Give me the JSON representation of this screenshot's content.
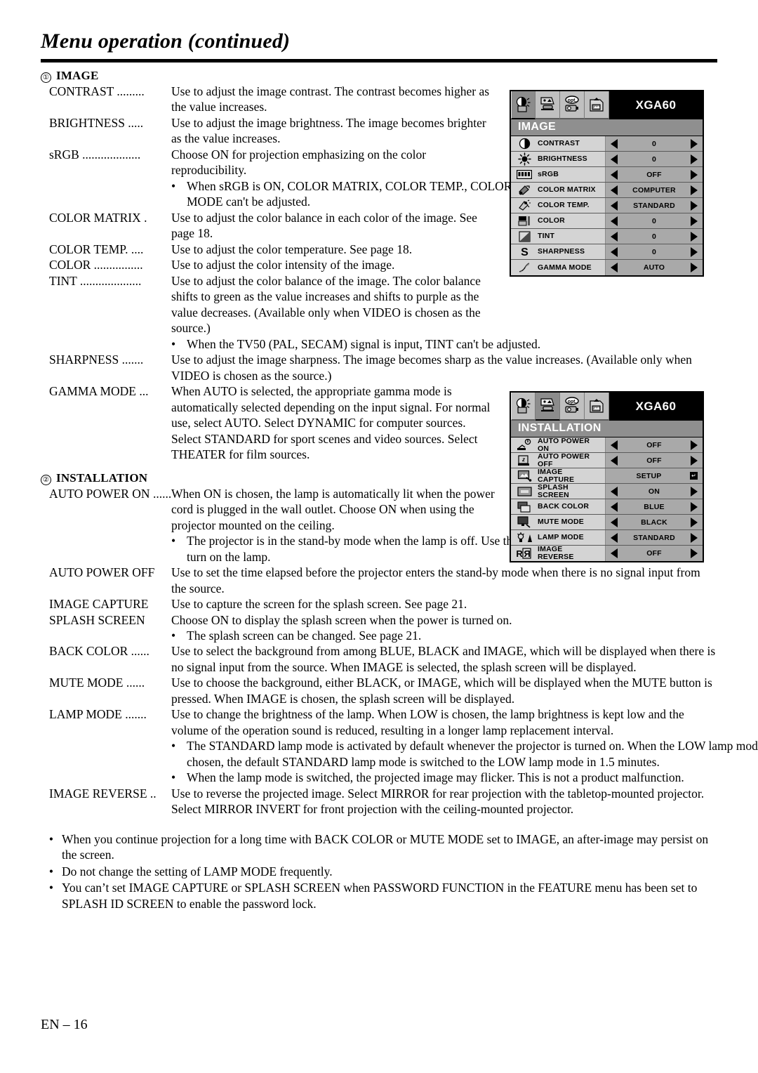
{
  "page": {
    "title": "Menu operation (continued)",
    "footer": "EN – 16"
  },
  "sections": [
    {
      "number": "①",
      "heading": "IMAGE",
      "entries": [
        {
          "term": "CONTRAST .........",
          "desc": "Use to adjust the image contrast. The contrast becomes higher as the value increases."
        },
        {
          "term": "BRIGHTNESS .....",
          "desc": "Use to adjust the image brightness. The image becomes brighter as the value increases."
        },
        {
          "term": "sRGB ...................",
          "desc": "Choose ON for projection emphasizing on the color reproducibility."
        },
        {
          "bullet": "When sRGB is ON, COLOR MATRIX, COLOR TEMP., COLOR, TINT, and GAMMA MODE can't be adjusted."
        },
        {
          "term": "COLOR MATRIX .",
          "desc": "Use to adjust the color balance in each color of the image. See page 18."
        },
        {
          "term": "COLOR TEMP. ....",
          "desc": "Use to adjust the color temperature. See page 18."
        },
        {
          "term": "COLOR ................",
          "desc": "Use to adjust the color intensity of the image."
        },
        {
          "term": "TINT ....................",
          "desc": "Use to adjust the color balance of the image. The color balance shifts to green as the value increases and shifts to purple as the value decreases. (Available only when VIDEO is chosen as the source.)"
        },
        {
          "bullet": "When the TV50 (PAL, SECAM) signal is input, TINT can't be adjusted."
        },
        {
          "term": "SHARPNESS .......",
          "desc": "Use to adjust the image sharpness. The image becomes sharp as the value increases. (Available only when VIDEO is chosen as the source.)"
        },
        {
          "term": "GAMMA MODE ...",
          "desc": "When AUTO is selected, the appropriate gamma mode is automatically selected depending on the input signal. For normal use, select  AUTO. Select DYNAMIC for computer sources. Select STANDARD for sport scenes and video sources. Select THEATER for film sources."
        }
      ]
    },
    {
      "number": "②",
      "heading": "INSTALLATION",
      "entries": [
        {
          "term": "AUTO POWER ON ......",
          "desc": "When ON is chosen, the lamp is automatically lit when the power cord is plugged in the wall outlet. Choose ON when using the projector mounted on the ceiling."
        },
        {
          "bullet": "The projector is in the stand-by mode when the lamp is off.  Use the remote control to turn on the lamp."
        },
        {
          "term": "AUTO POWER OFF",
          "desc": "Use to set the time elapsed before the projector enters the stand-by mode when there is no signal input from the source."
        },
        {
          "term": "IMAGE CAPTURE",
          "desc": "Use to capture the screen for the splash screen. See page 21."
        },
        {
          "term": "SPLASH SCREEN",
          "desc": "Choose ON to display the splash screen when the power is turned on."
        },
        {
          "bullet": "The splash screen can be changed. See page 21."
        },
        {
          "term": "BACK COLOR ......",
          "desc": "Use to select the background from among BLUE, BLACK and IMAGE, which will be displayed when there is no signal input from the source. When IMAGE is selected, the splash screen will be displayed."
        },
        {
          "term": "MUTE MODE ......",
          "desc": "Use to choose the background, either BLACK, or IMAGE, which will be displayed when the MUTE button is pressed. When IMAGE is chosen, the splash screen will be displayed."
        },
        {
          "term": "LAMP MODE .......",
          "desc": "Use to change the brightness of the lamp. When LOW is chosen, the lamp brightness is kept low and the volume of the operation sound is reduced, resulting in a longer lamp replacement interval."
        },
        {
          "bullet": "The STANDARD lamp mode is activated by default whenever the projector is turned on. When the LOW lamp mode has been chosen, the default STANDARD lamp mode is switched to the LOW lamp mode in 1.5 minutes."
        },
        {
          "bullet": "When the lamp mode is switched, the projected image may flicker. This is not a product malfunction."
        },
        {
          "term": "IMAGE REVERSE ..",
          "desc": "Use to reverse the projected image. Select MIRROR for rear projection with the tabletop-mounted projector. Select MIRROR INVERT for front projection with the ceiling-mounted projector."
        }
      ]
    }
  ],
  "notes": [
    "When you continue projection for a long time with BACK COLOR or MUTE MODE set to IMAGE, an after-image may persist on the screen.",
    "Do not change the setting of LAMP MODE frequently.",
    "You can’t set IMAGE CAPTURE or SPLASH SCREEN when PASSWORD FUNCTION in the FEATURE menu has been set to SPLASH ID SCREEN to enable the password lock."
  ],
  "osd": {
    "image_menu": {
      "signal_label": "XGA60",
      "section_title": "IMAGE",
      "selected_tab_index": 0,
      "tabs": [
        "image-tab-icon",
        "installation-tab-icon",
        "option-tab-icon",
        "feature-tab-icon"
      ],
      "rows": [
        {
          "icon": "contrast-icon",
          "label": "CONTRAST",
          "value": "0",
          "arrows": true
        },
        {
          "icon": "brightness-icon",
          "label": "BRIGHTNESS",
          "value": "0",
          "arrows": true
        },
        {
          "icon": "srgb-icon",
          "label": "sRGB",
          "value": "OFF",
          "arrows": true
        },
        {
          "icon": "color-matrix-icon",
          "label": "COLOR MATRIX",
          "value": "COMPUTER",
          "arrows": true
        },
        {
          "icon": "color-temp-icon",
          "label": "COLOR TEMP.",
          "value": "STANDARD",
          "arrows": true
        },
        {
          "icon": "color-icon",
          "label": "COLOR",
          "value": "0",
          "arrows": true
        },
        {
          "icon": "tint-icon",
          "label": "TINT",
          "value": "0",
          "arrows": true
        },
        {
          "icon": "sharpness-icon",
          "label": "SHARPNESS",
          "value": "0",
          "arrows": true
        },
        {
          "icon": "gamma-mode-icon",
          "label": "GAMMA MODE",
          "value": "AUTO",
          "arrows": true
        }
      ]
    },
    "installation_menu": {
      "signal_label": "XGA60",
      "section_title": "INSTALLATION",
      "selected_tab_index": 1,
      "tabs": [
        "image-tab-icon",
        "installation-tab-icon",
        "option-tab-icon",
        "feature-tab-icon"
      ],
      "rows": [
        {
          "icon": "auto-power-on-icon",
          "label": "AUTO POWER\nON",
          "value": "OFF",
          "arrows": true
        },
        {
          "icon": "auto-power-off-icon",
          "label": "AUTO POWER\nOFF",
          "value": "OFF",
          "arrows": true
        },
        {
          "icon": "image-capture-icon",
          "label": "IMAGE\nCAPTURE",
          "value": "SETUP",
          "arrows": false,
          "enter": true
        },
        {
          "icon": "splash-screen-icon",
          "label": "SPLASH\nSCREEN",
          "value": "ON",
          "arrows": true
        },
        {
          "icon": "back-color-icon",
          "label": "BACK COLOR",
          "value": "BLUE",
          "arrows": true
        },
        {
          "icon": "mute-mode-icon",
          "label": "MUTE MODE",
          "value": "BLACK",
          "arrows": true
        },
        {
          "icon": "lamp-mode-icon",
          "label": "LAMP MODE",
          "value": "STANDARD",
          "arrows": true
        },
        {
          "icon": "image-reverse-icon",
          "label": "IMAGE\nREVERSE",
          "value": "OFF",
          "arrows": true
        }
      ]
    }
  }
}
